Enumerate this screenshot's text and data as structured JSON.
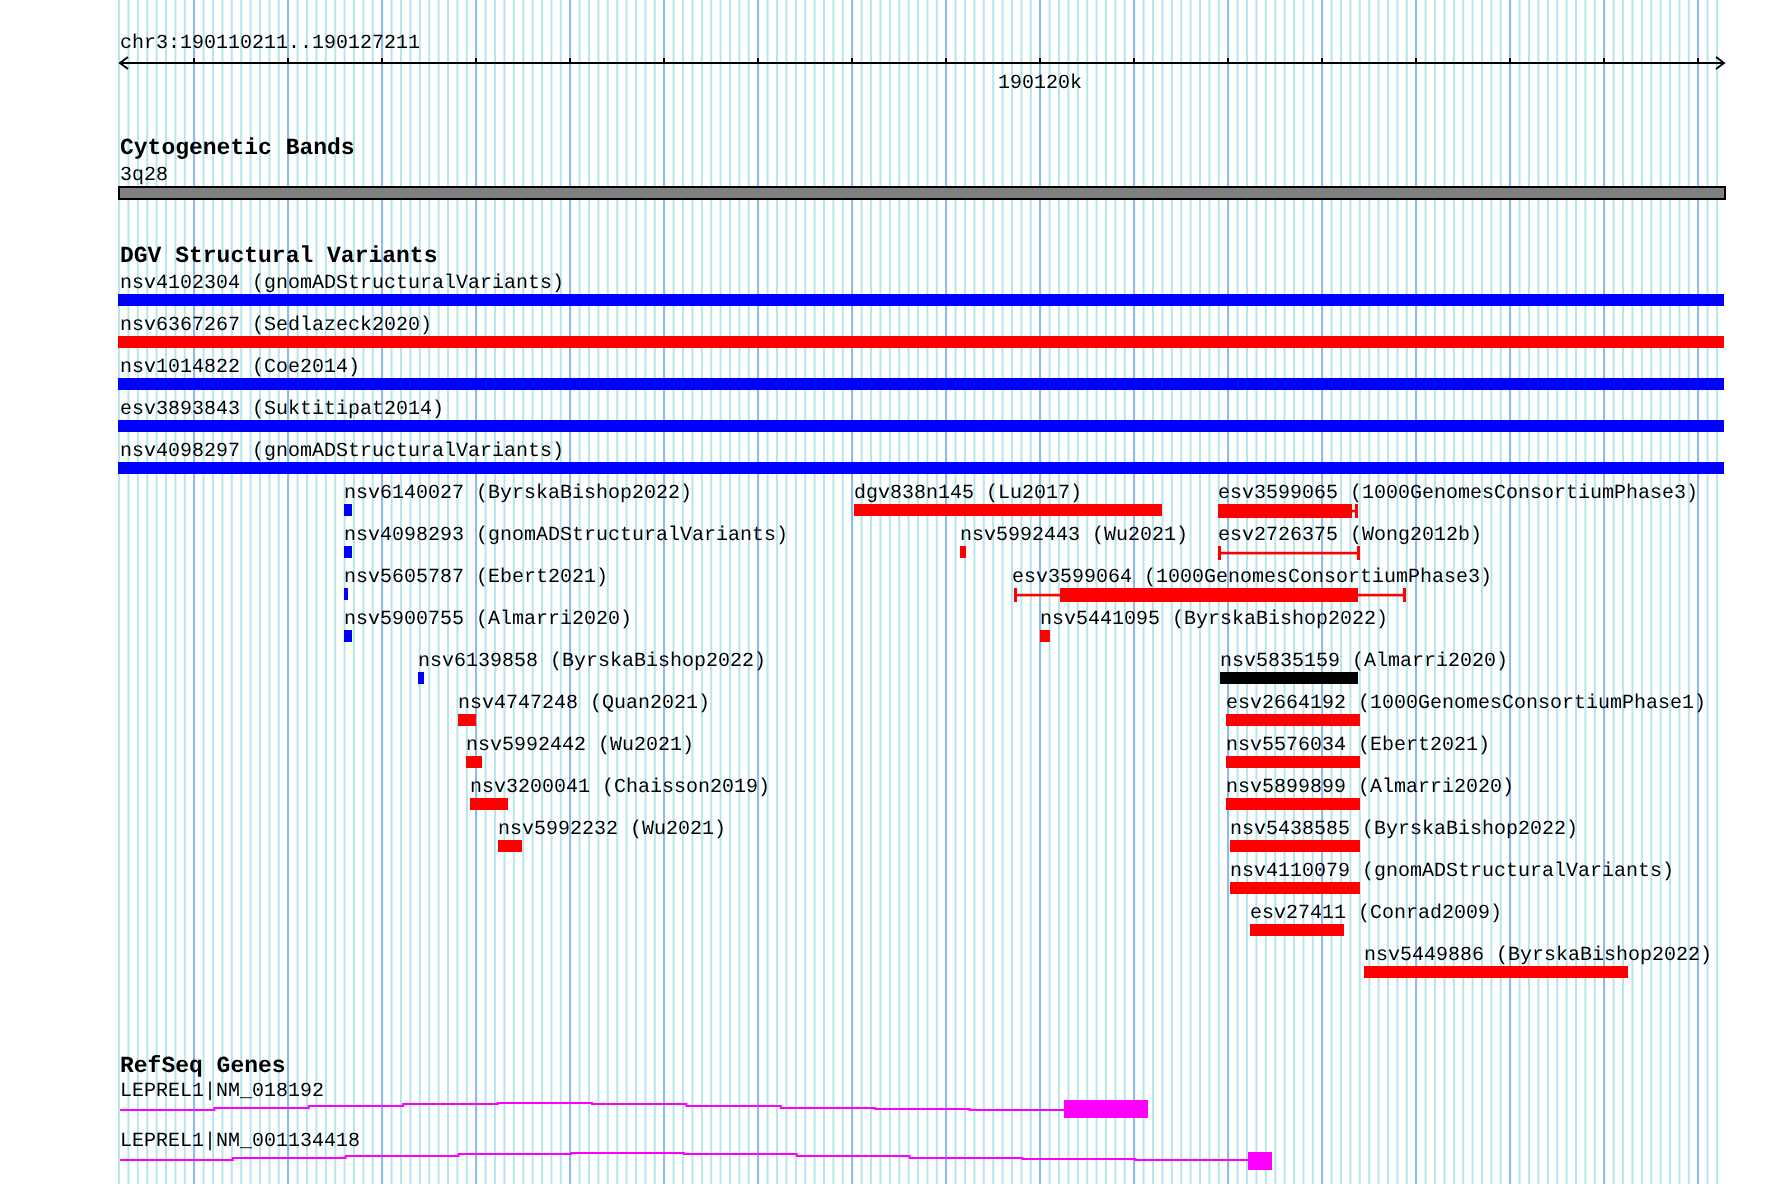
{
  "ruler": {
    "location": "chr3:190110211..190127211",
    "tick_label": "190120k"
  },
  "tracks": [
    {
      "title": "Cytogenetic Bands",
      "features": [
        {
          "label": "3q28",
          "kind": "band"
        }
      ]
    },
    {
      "title": "DGV Structural Variants",
      "features": [
        {
          "label": "nsv4102304 (gnomADStructuralVariants)",
          "kind": "bar",
          "color": "#0000ff"
        },
        {
          "label": "nsv6367267 (Sedlazeck2020)",
          "kind": "bar",
          "color": "#ff0000"
        },
        {
          "label": "nsv1014822 (Coe2014)",
          "kind": "bar",
          "color": "#0000ff"
        },
        {
          "label": "esv3893843 (Suktitipat2014)",
          "kind": "bar",
          "color": "#0000ff"
        },
        {
          "label": "nsv4098297 (gnomADStructuralVariants)",
          "kind": "bar",
          "color": "#0000ff"
        },
        {
          "label": "nsv6140027 (ByrskaBishop2022)",
          "kind": "bar",
          "color": "#0000ff"
        },
        {
          "label": "dgv838n145 (Lu2017)",
          "kind": "bar",
          "color": "#ff0000"
        },
        {
          "label": "esv3599065 (1000GenomesConsortiumPhase3)",
          "kind": "range",
          "color": "#ff0000"
        },
        {
          "label": "nsv4098293 (gnomADStructuralVariants)",
          "kind": "bar",
          "color": "#0000ff"
        },
        {
          "label": "nsv5992443 (Wu2021)",
          "kind": "bar",
          "color": "#ff0000"
        },
        {
          "label": "esv2726375 (Wong2012b)",
          "kind": "range",
          "color": "#ff0000"
        },
        {
          "label": "nsv5605787 (Ebert2021)",
          "kind": "bar",
          "color": "#0000ff"
        },
        {
          "label": "esv3599064 (1000GenomesConsortiumPhase3)",
          "kind": "range",
          "color": "#ff0000"
        },
        {
          "label": "nsv5900755 (Almarri2020)",
          "kind": "bar",
          "color": "#0000ff"
        },
        {
          "label": "nsv5441095 (ByrskaBishop2022)",
          "kind": "bar",
          "color": "#ff0000"
        },
        {
          "label": "nsv6139858 (ByrskaBishop2022)",
          "kind": "bar",
          "color": "#0000ff"
        },
        {
          "label": "nsv5835159 (Almarri2020)",
          "kind": "bar",
          "color": "#000000"
        },
        {
          "label": "nsv4747248 (Quan2021)",
          "kind": "bar",
          "color": "#ff0000"
        },
        {
          "label": "esv2664192 (1000GenomesConsortiumPhase1)",
          "kind": "bar",
          "color": "#ff0000"
        },
        {
          "label": "nsv5992442 (Wu2021)",
          "kind": "bar",
          "color": "#ff0000"
        },
        {
          "label": "nsv5576034 (Ebert2021)",
          "kind": "bar",
          "color": "#ff0000"
        },
        {
          "label": "nsv3200041 (Chaisson2019)",
          "kind": "bar",
          "color": "#ff0000"
        },
        {
          "label": "nsv5899899 (Almarri2020)",
          "kind": "bar",
          "color": "#ff0000"
        },
        {
          "label": "nsv5992232 (Wu2021)",
          "kind": "bar",
          "color": "#ff0000"
        },
        {
          "label": "nsv5438585 (ByrskaBishop2022)",
          "kind": "bar",
          "color": "#ff0000"
        },
        {
          "label": "nsv4110079 (gnomADStructuralVariants)",
          "kind": "bar",
          "color": "#ff0000"
        },
        {
          "label": "esv27411 (Conrad2009)",
          "kind": "bar",
          "color": "#ff0000"
        },
        {
          "label": "nsv5449886 (ByrskaBishop2022)",
          "kind": "bar",
          "color": "#ff0000"
        }
      ]
    },
    {
      "title": "RefSeq Genes",
      "features": [
        {
          "label": "LEPREL1|NM_018192",
          "kind": "gene"
        },
        {
          "label": "LEPREL1|NM_001134418",
          "kind": "gene"
        }
      ]
    }
  ]
}
